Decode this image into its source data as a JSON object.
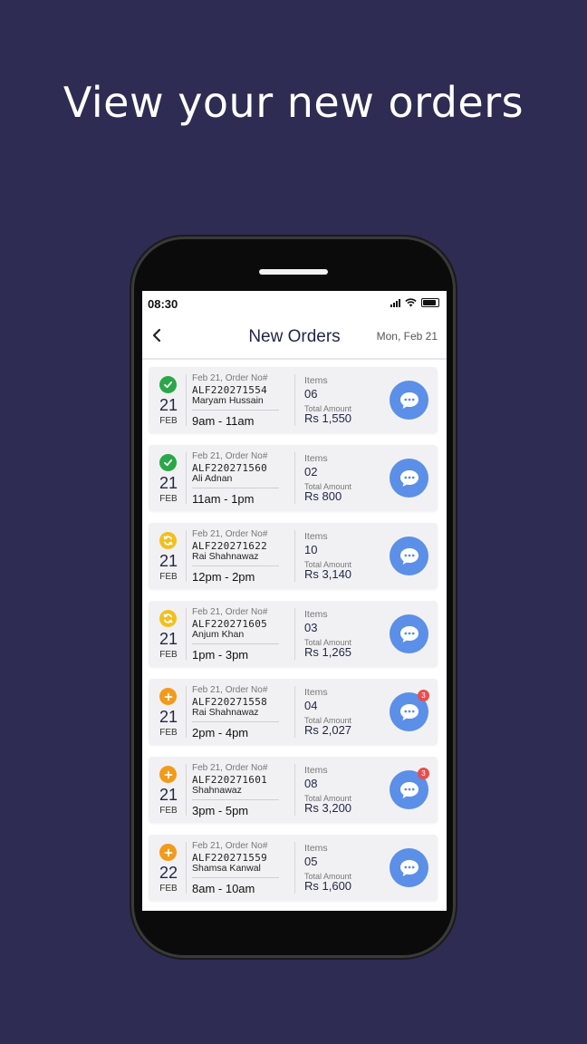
{
  "headline": "View your new orders",
  "status_bar": {
    "time": "08:30"
  },
  "navbar": {
    "title": "New Orders",
    "date": "Mon, Feb 21"
  },
  "labels": {
    "items": "Items",
    "total_amount": "Total Amount"
  },
  "colors": {
    "background": "#2e2c52",
    "accent": "#5b8fe8",
    "status_done": "#2aa748",
    "status_processing": "#f2c01e",
    "status_new": "#f39a1b",
    "badge": "#e84e4e"
  },
  "orders": [
    {
      "status": "done",
      "status_icon": "check-icon",
      "day": "21",
      "month": "FEB",
      "meta": "Feb 21, Order No#",
      "order_no": "ALF220271554",
      "customer": "Maryam Hussain",
      "slot": "9am - 11am",
      "items": "06",
      "amount": "Rs 1,550",
      "badge": ""
    },
    {
      "status": "done",
      "status_icon": "check-icon",
      "day": "21",
      "month": "FEB",
      "meta": "Feb 21, Order No#",
      "order_no": "ALF220271560",
      "customer": "Ali Adnan",
      "slot": "11am - 1pm",
      "items": "02",
      "amount": "Rs 800",
      "badge": ""
    },
    {
      "status": "processing",
      "status_icon": "refresh-icon",
      "day": "21",
      "month": "FEB",
      "meta": "Feb 21, Order No#",
      "order_no": "ALF220271622",
      "customer": "Rai Shahnawaz",
      "slot": "12pm - 2pm",
      "items": "10",
      "amount": "Rs 3,140",
      "badge": ""
    },
    {
      "status": "processing",
      "status_icon": "refresh-icon",
      "day": "21",
      "month": "FEB",
      "meta": "Feb 21, Order No#",
      "order_no": "ALF220271605",
      "customer": "Anjum Khan",
      "slot": "1pm - 3pm",
      "items": "03",
      "amount": "Rs 1,265",
      "badge": ""
    },
    {
      "status": "new",
      "status_icon": "plus-icon",
      "day": "21",
      "month": "FEB",
      "meta": "Feb 21, Order No#",
      "order_no": "ALF220271558",
      "customer": "Rai Shahnawaz",
      "slot": "2pm - 4pm",
      "items": "04",
      "amount": "Rs 2,027",
      "badge": "3"
    },
    {
      "status": "new",
      "status_icon": "plus-icon",
      "day": "21",
      "month": "FEB",
      "meta": "Feb 21, Order No#",
      "order_no": "ALF220271601",
      "customer": "Shahnawaz",
      "slot": "3pm - 5pm",
      "items": "08",
      "amount": "Rs 3,200",
      "badge": "3"
    },
    {
      "status": "new",
      "status_icon": "plus-icon",
      "day": "22",
      "month": "FEB",
      "meta": "Feb 21, Order No#",
      "order_no": "ALF220271559",
      "customer": "Shamsa Kanwal",
      "slot": "8am - 10am",
      "items": "05",
      "amount": "Rs 1,600",
      "badge": ""
    }
  ]
}
